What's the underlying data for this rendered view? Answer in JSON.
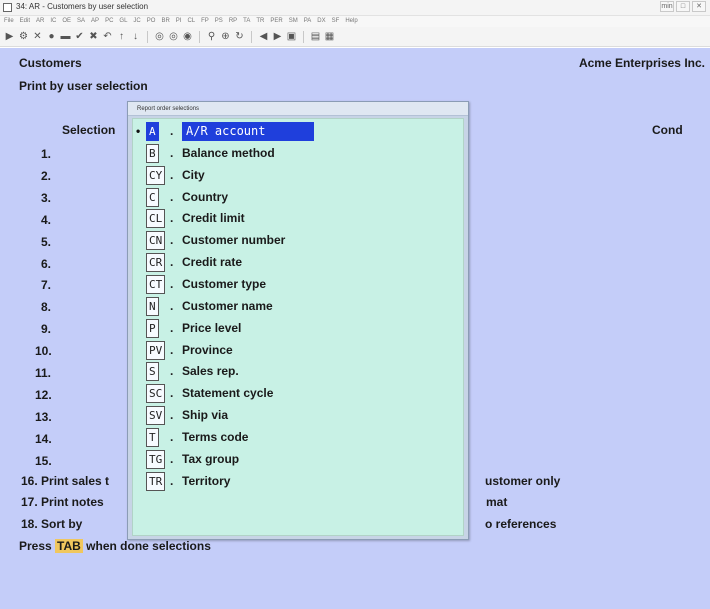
{
  "window": {
    "title": "34: AR - Customers by user selection",
    "buttons": [
      "min",
      "□",
      "✕"
    ]
  },
  "menubar": [
    "File",
    "Edit",
    "AR",
    "IC",
    "OE",
    "SA",
    "AP",
    "PC",
    "GL",
    "JC",
    "PO",
    "BR",
    "PI",
    "CL",
    "FP",
    "PS",
    "RP",
    "TA",
    "TR",
    "PER",
    "SM",
    "PA",
    "DX",
    "SF",
    "Help"
  ],
  "screen": {
    "heading": "Customers",
    "company": "Acme Enterprises Inc.",
    "subheading": "Print by user selection",
    "selection_header": "Selection",
    "cond_header": "Cond",
    "line_numbers": [
      "1.",
      "2.",
      "3.",
      "4.",
      "5.",
      "6.",
      "7.",
      "8.",
      "9.",
      "10.",
      "11.",
      "12.",
      "13.",
      "14.",
      "15."
    ],
    "option_16": "16. Print sales t",
    "option_16_value": "ustomer only",
    "option_17": "17. Print notes",
    "option_17_value": "mat",
    "option_18": "18. Sort by",
    "option_18_value": "o references",
    "prompt_before": "Press",
    "prompt_key": "TAB",
    "prompt_after": "when done selections"
  },
  "popup": {
    "title": "Report order selections",
    "selected_marker": "•",
    "options": [
      {
        "code": "A",
        "label": "A/R account",
        "selected": true
      },
      {
        "code": "B",
        "label": "Balance method"
      },
      {
        "code": "CY",
        "label": "City"
      },
      {
        "code": "C",
        "label": "Country"
      },
      {
        "code": "CL",
        "label": "Credit limit"
      },
      {
        "code": "CN",
        "label": "Customer number"
      },
      {
        "code": "CR",
        "label": "Credit rate"
      },
      {
        "code": "CT",
        "label": "Customer type"
      },
      {
        "code": "N",
        "label": "Customer name"
      },
      {
        "code": "P",
        "label": "Price level"
      },
      {
        "code": "PV",
        "label": "Province"
      },
      {
        "code": "S",
        "label": "Sales rep."
      },
      {
        "code": "SC",
        "label": "Statement cycle"
      },
      {
        "code": "SV",
        "label": "Ship via"
      },
      {
        "code": "T",
        "label": "Terms code"
      },
      {
        "code": "TG",
        "label": "Tax group"
      },
      {
        "code": "TR",
        "label": "Territory"
      }
    ]
  },
  "colors": {
    "screen_bg": "#c4cdf9",
    "popup_body_bg": "#c8f1e5",
    "selection_highlight": "#1f3fdc",
    "tab_key_bg": "#f0c75e"
  }
}
